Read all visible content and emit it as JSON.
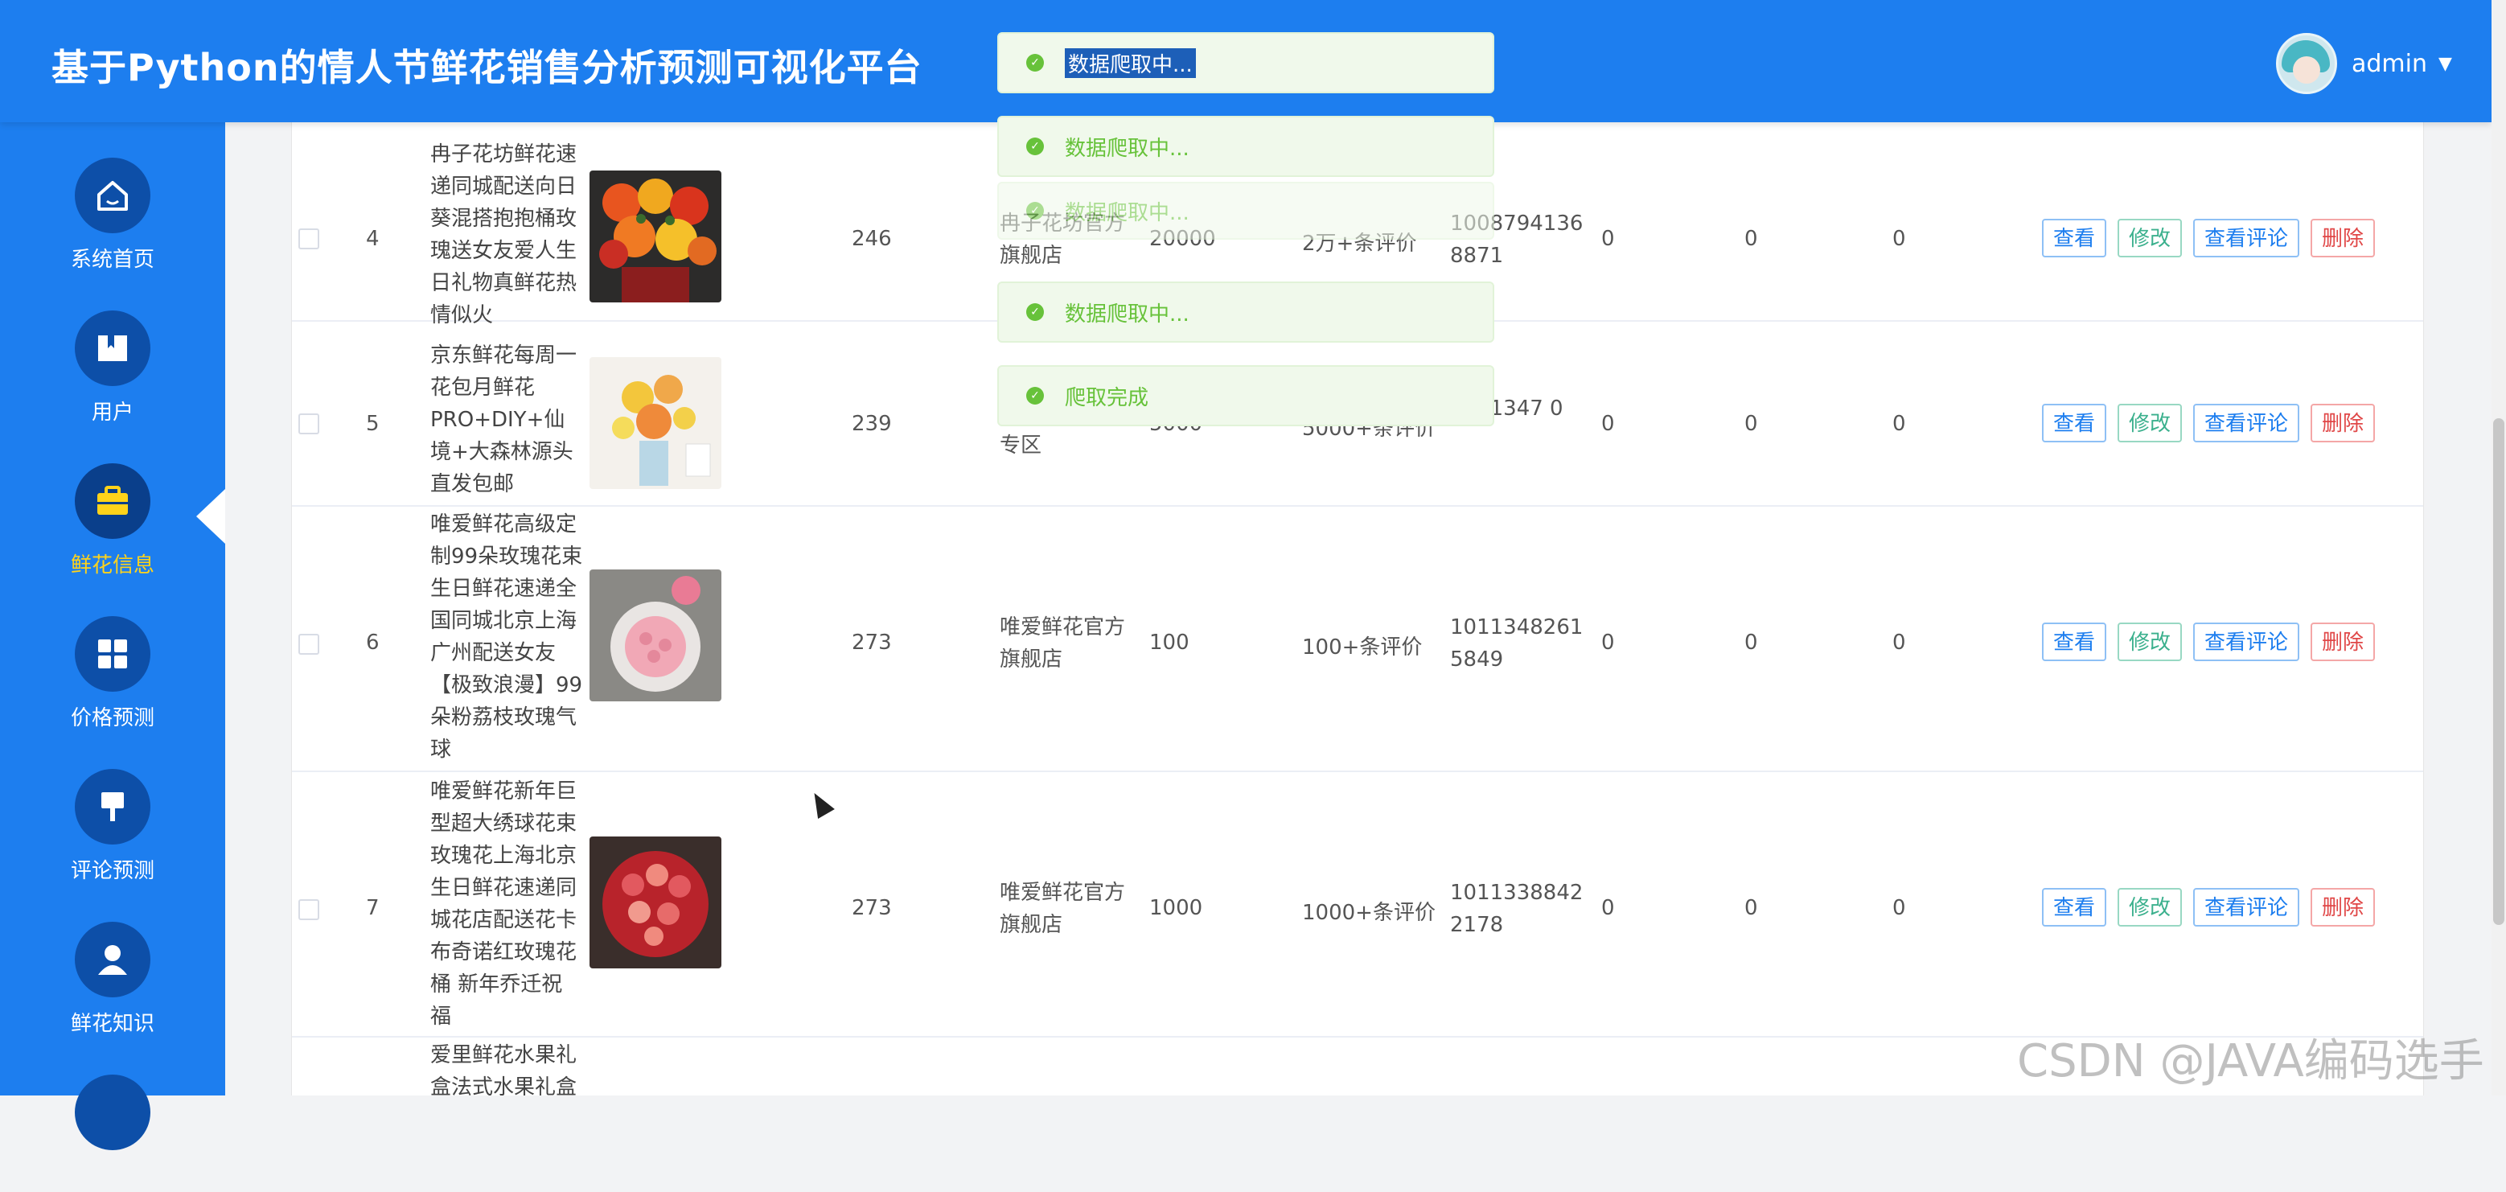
{
  "header": {
    "title": "基于Python的情人节鲜花销售分析预测可视化平台",
    "username": "admin"
  },
  "sidebar": {
    "items": [
      {
        "label": "系统首页",
        "icon": "home-icon"
      },
      {
        "label": "用户",
        "icon": "bookmark-icon"
      },
      {
        "label": "鲜花信息",
        "icon": "briefcase-icon"
      },
      {
        "label": "价格预测",
        "icon": "grid-icon"
      },
      {
        "label": "评论预测",
        "icon": "brush-icon"
      },
      {
        "label": "鲜花知识",
        "icon": "user-icon"
      }
    ],
    "active_index": 2
  },
  "toasts": [
    {
      "text": "数据爬取中..."
    },
    {
      "text": "数据爬取中..."
    },
    {
      "text": "数据爬取中..."
    },
    {
      "text": "数据爬取中..."
    },
    {
      "text": "爬取完成"
    }
  ],
  "actions": {
    "view": "查看",
    "edit": "修改",
    "comments": "查看评论",
    "delete": "删除"
  },
  "rows": [
    {
      "index": "4",
      "name": "冉子花坊鲜花速递同城配送向日葵混搭抱抱桶玫瑰送女友爱人生日礼物真鲜花热情似火",
      "num": "246",
      "shop": "冉子花坊官方旗舰店",
      "a": "20000",
      "b": "2万+条评价",
      "c": "10087941368871",
      "d": "0",
      "e": "0",
      "f": "0"
    },
    {
      "index": "5",
      "name": "京东鲜花每周一花包月鲜花PRO+DIY+仙境+大森林源头直发包邮",
      "num": "239",
      "shop": "专区",
      "a": "5000",
      "b": "5000+条评价",
      "c": "5341347 0",
      "d": "0",
      "e": "0",
      "f": "0"
    },
    {
      "index": "6",
      "name": "唯爱鲜花高级定制99朵玫瑰花束生日鲜花速递全国同城北京上海广州配送女友【极致浪漫】99朵粉荔枝玫瑰气球",
      "num": "273",
      "shop": "唯爱鲜花官方旗舰店",
      "a": "100",
      "b": "100+条评价",
      "c": "10113482615849",
      "d": "0",
      "e": "0",
      "f": "0"
    },
    {
      "index": "7",
      "name": "唯爱鲜花新年巨型超大绣球花束玫瑰花上海北京生日鲜花速递同城花店配送花卡布奇诺红玫瑰花桶 新年乔迁祝福",
      "num": "273",
      "shop": "唯爱鲜花官方旗舰店",
      "a": "1000",
      "b": "1000+条评价",
      "c": "10113388422178",
      "d": "0",
      "e": "0",
      "f": "0"
    },
    {
      "index": "",
      "name": "爱里鲜花水果礼盒法式水果礼盒"
    }
  ],
  "watermark": "CSDN @JAVA编码选手"
}
